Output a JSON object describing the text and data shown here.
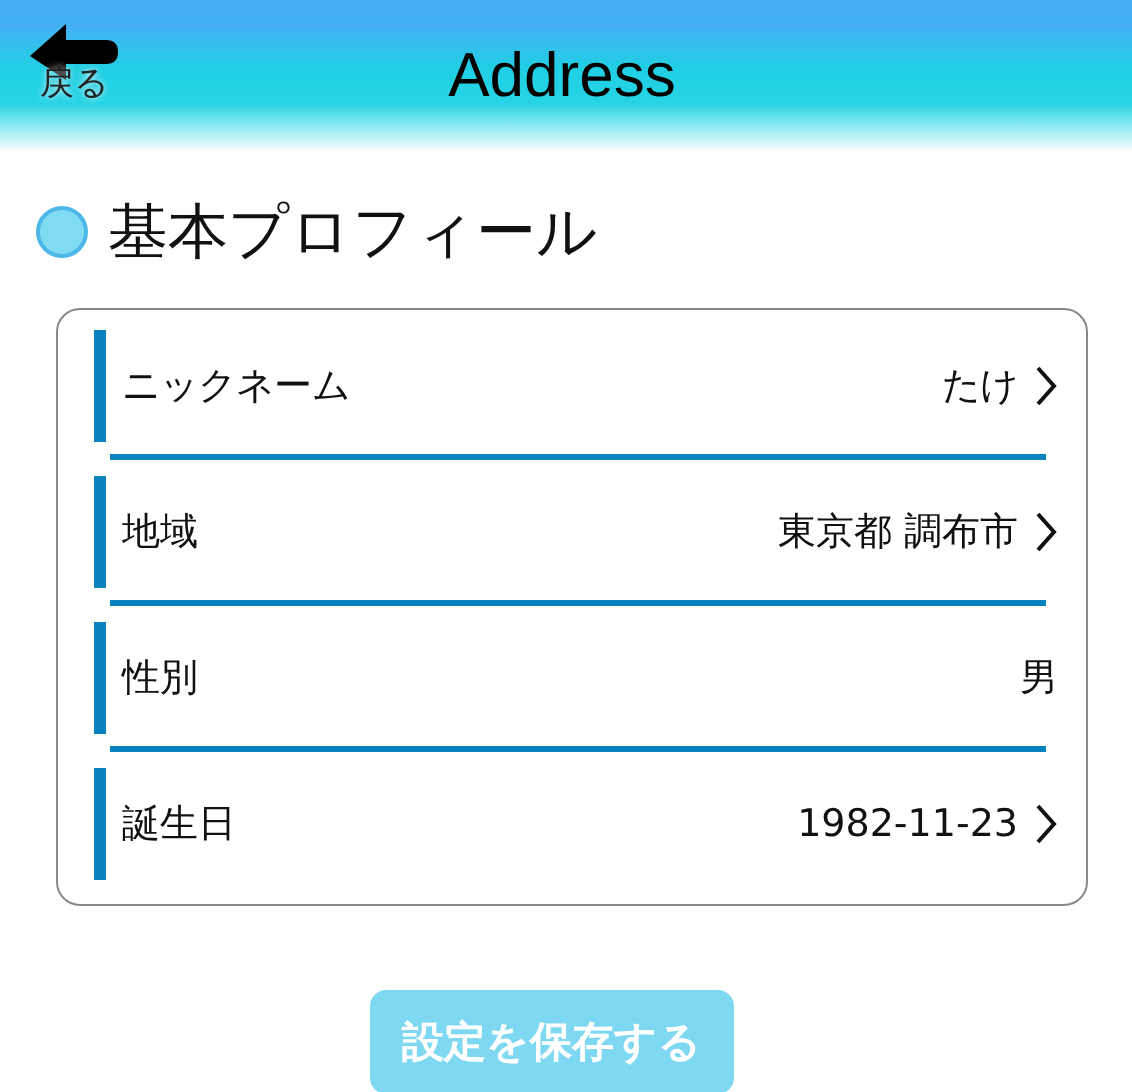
{
  "header": {
    "back_label": "戻る",
    "title": "Address"
  },
  "section": {
    "title": "基本プロフィール"
  },
  "rows": [
    {
      "label": "ニックネーム",
      "value": "たけ",
      "chevron": true
    },
    {
      "label": "地域",
      "value": "東京都 調布市",
      "chevron": true
    },
    {
      "label": "性別",
      "value": "男",
      "chevron": false
    },
    {
      "label": "誕生日",
      "value": "1982-11-23",
      "chevron": true
    }
  ],
  "save_button": "設定を保存する"
}
